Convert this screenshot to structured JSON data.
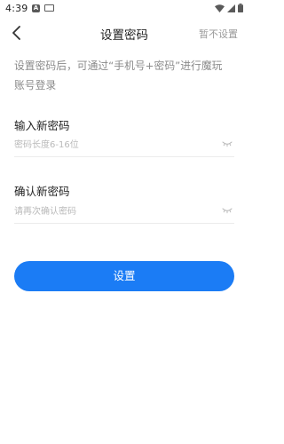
{
  "status_bar": {
    "time": "4:39",
    "notif_letter": "A"
  },
  "nav": {
    "title": "设置密码",
    "skip_label": "暂不设置"
  },
  "hint": {
    "line1": "设置密码后，可通过“手机号+密码”进行魔玩",
    "line2": "账号登录"
  },
  "new_password": {
    "label": "输入新密码",
    "placeholder": "密码长度6-16位",
    "value": ""
  },
  "confirm_password": {
    "label": "确认新密码",
    "placeholder": "请再次确认密码",
    "value": ""
  },
  "submit": {
    "label": "设置"
  },
  "colors": {
    "primary": "#1b7cf5",
    "hint_text": "#8a8a8a",
    "placeholder": "#b9b9b9"
  },
  "icons": [
    "back-arrow-icon",
    "eye-closed-icon",
    "wifi-icon",
    "signal-icon",
    "battery-icon"
  ]
}
